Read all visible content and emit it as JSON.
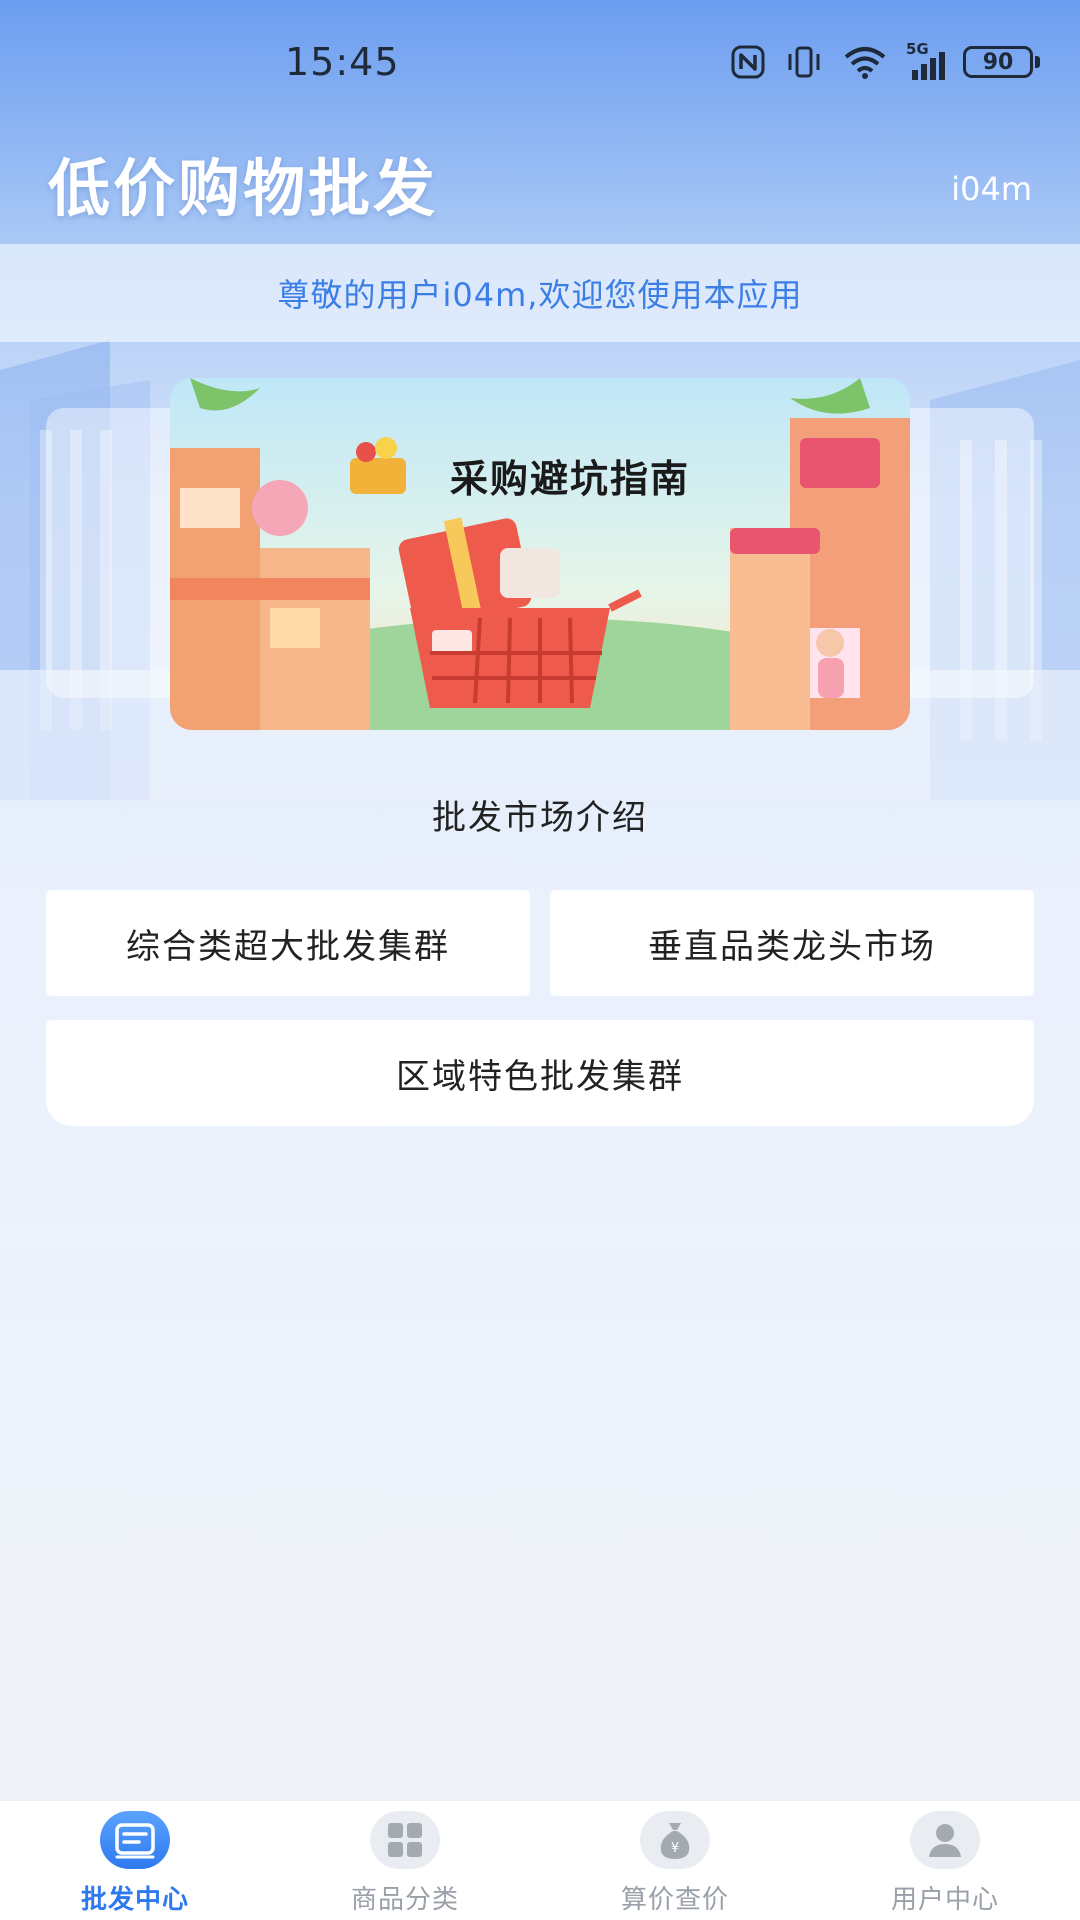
{
  "status_bar": {
    "time": "15:45",
    "network": "5G",
    "battery": "90",
    "icons": [
      "nfc-icon",
      "vibrate-icon",
      "wifi-icon",
      "signal-5g-icon",
      "battery-icon"
    ]
  },
  "header": {
    "title": "低价购物批发",
    "username": "i04m"
  },
  "welcome": {
    "text": "尊敬的用户i04m,欢迎您使用本应用"
  },
  "banner": {
    "title": "采购避坑指南",
    "image": "shopping-cart-market-illustration"
  },
  "markets": {
    "section_title": "批发市场介绍",
    "items": [
      {
        "label": "综合类超大批发集群"
      },
      {
        "label": "垂直品类龙头市场"
      },
      {
        "label": "区域特色批发集群"
      }
    ]
  },
  "nav": {
    "items": [
      {
        "label": "批发中心",
        "icon": "wholesale-icon",
        "active": true
      },
      {
        "label": "商品分类",
        "icon": "grid-icon",
        "active": false
      },
      {
        "label": "算价查价",
        "icon": "money-bag-icon",
        "active": false
      },
      {
        "label": "用户中心",
        "icon": "user-icon",
        "active": false
      }
    ]
  },
  "colors": {
    "accent": "#2e79f0",
    "welcome_text": "#3b7ee6",
    "inactive_nav": "#9aa0a8"
  }
}
